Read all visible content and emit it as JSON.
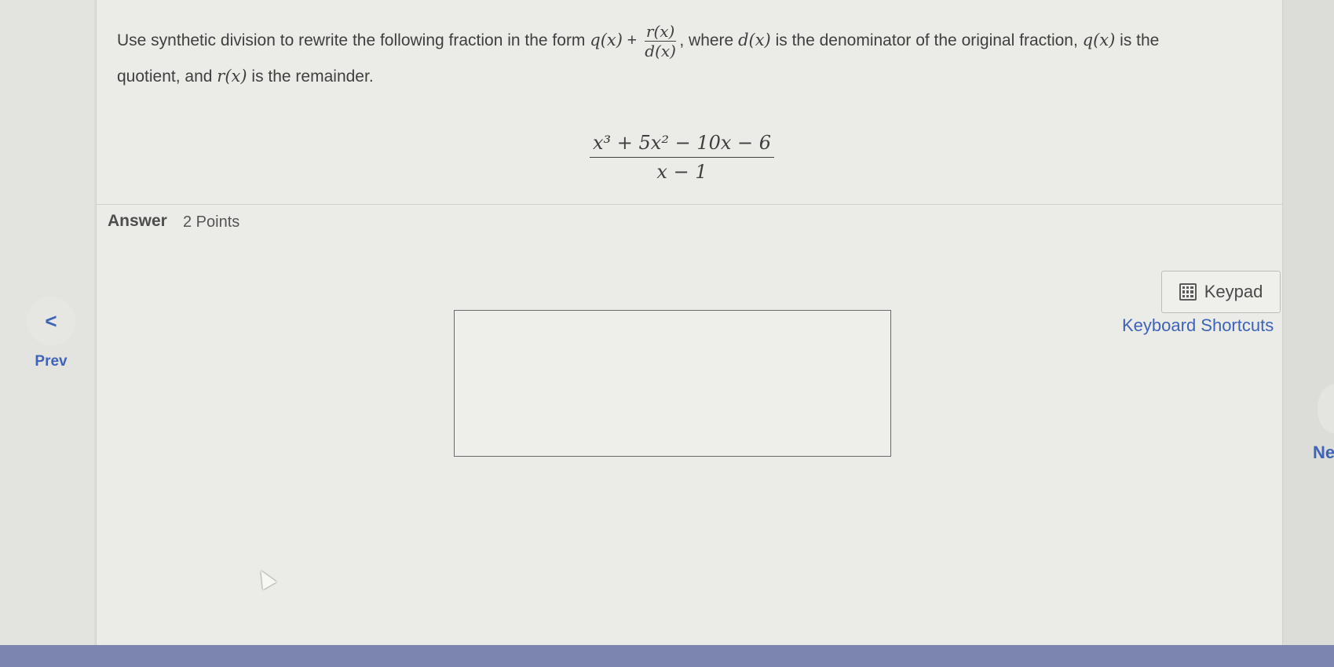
{
  "question": {
    "intro": "Use synthetic division to rewrite the following fraction in the form",
    "q_expr": "q(x)",
    "plus": "+",
    "frac_num": "r(x)",
    "frac_den": "d(x)",
    "mid": ", where",
    "d_expr": "d(x)",
    "denom_text": "is the denominator of the original fraction,",
    "q_expr2": "q(x)",
    "is_the": "is the",
    "quotient_text": "quotient, and",
    "r_expr": "r(x)",
    "remainder_text": "is the remainder.",
    "fraction_numerator": "x³ + 5x² − 10x − 6",
    "fraction_denominator": "x − 1"
  },
  "answer": {
    "label": "Answer",
    "points": "2 Points",
    "input_value": ""
  },
  "tools": {
    "keypad_label": "Keypad",
    "keypad_icon": "calculator-icon",
    "shortcuts_label": "Keyboard Shortcuts"
  },
  "nav": {
    "prev_symbol": "<",
    "prev_label": "Prev",
    "next_label": "Ne"
  },
  "colors": {
    "accent": "#3e63b8",
    "panel": "#ebebe7"
  }
}
